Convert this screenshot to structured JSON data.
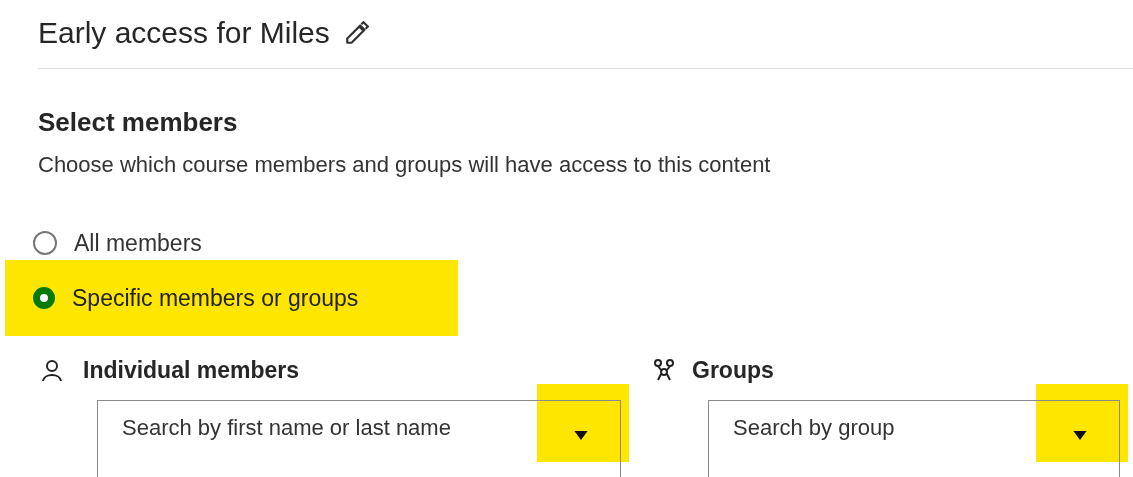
{
  "title": "Early access for Miles",
  "section": {
    "heading": "Select members",
    "description": "Choose which course members and groups will have access to this content"
  },
  "options": [
    {
      "label": "All members",
      "selected": false,
      "highlighted": false
    },
    {
      "label": "Specific members or groups",
      "selected": true,
      "highlighted": true
    }
  ],
  "pickers": [
    {
      "kind": "person",
      "label": "Individual members",
      "placeholder": "Search by first name or last name",
      "arrow_highlighted": true
    },
    {
      "kind": "group",
      "label": "Groups",
      "placeholder": "Search by group",
      "arrow_highlighted": true
    }
  ]
}
